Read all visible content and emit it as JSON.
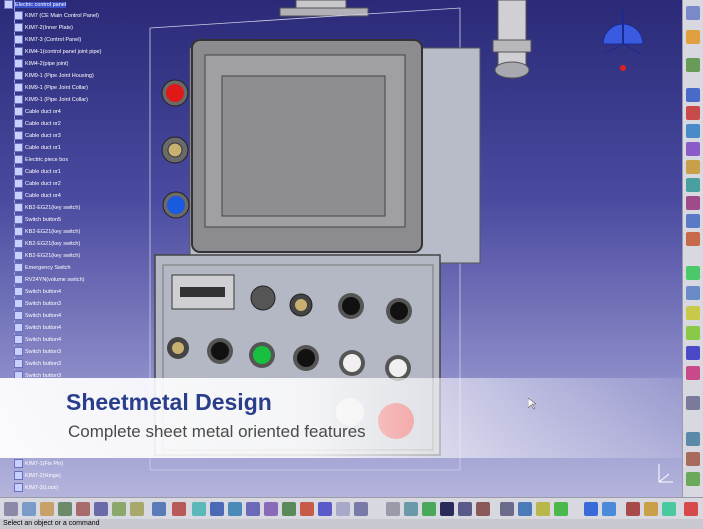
{
  "tree": {
    "items": [
      "Electric control panel",
      "KIM7 (CE Main Control Panel)",
      "KIM7-2(Inner Plate)",
      "KIM7-3 (Control Panel)",
      "KIM4-1(control panel joint pipe)",
      "KIM4-2(pipe joint)",
      "KIM9-1 (Pipe Joint Housing)",
      "KIM9-1 (Pipe Joint Collar)",
      "KIM9-1 (Pipe Joint Collar)",
      "Cable duct or4",
      "Cable duct or2",
      "Cable duct or3",
      "Cable duct or1",
      "Electric piece box",
      "Cable duct or1",
      "Cable duct or2",
      "Cable duct or4",
      "KB2-EG21(key switch)",
      "Switch button5",
      "KB2-EG21(key switch)",
      "KB2-EG21(key switch)",
      "KB2-EG21(key switch)",
      "Emergency Switch",
      "RV24YN(volume switch)",
      "Switch button4",
      "Switch button3",
      "Switch button4",
      "Switch button4",
      "Switch button4",
      "Switch button3",
      "Switch button3",
      "Switch button3"
    ],
    "bottom_items": [
      "KIM7-1(Fix Pin)",
      "KIM7-2(Hinge)",
      "KIM7-3(Lock)"
    ]
  },
  "banner": {
    "title": "Sheetmetal Design",
    "subtitle": "Complete sheet metal oriented features"
  },
  "status": {
    "prompt": "Select an object or a command"
  },
  "colors": {
    "banner_title": "#2a3f8c",
    "background_top": "#2a2a78",
    "background_bottom": "#b4b4dc",
    "red_button": "#e01818",
    "blue_button": "#1a5ae0",
    "green_button": "#18c040"
  },
  "icons": {
    "compass": "compass-icon",
    "cursor": "mouse-cursor-icon"
  }
}
